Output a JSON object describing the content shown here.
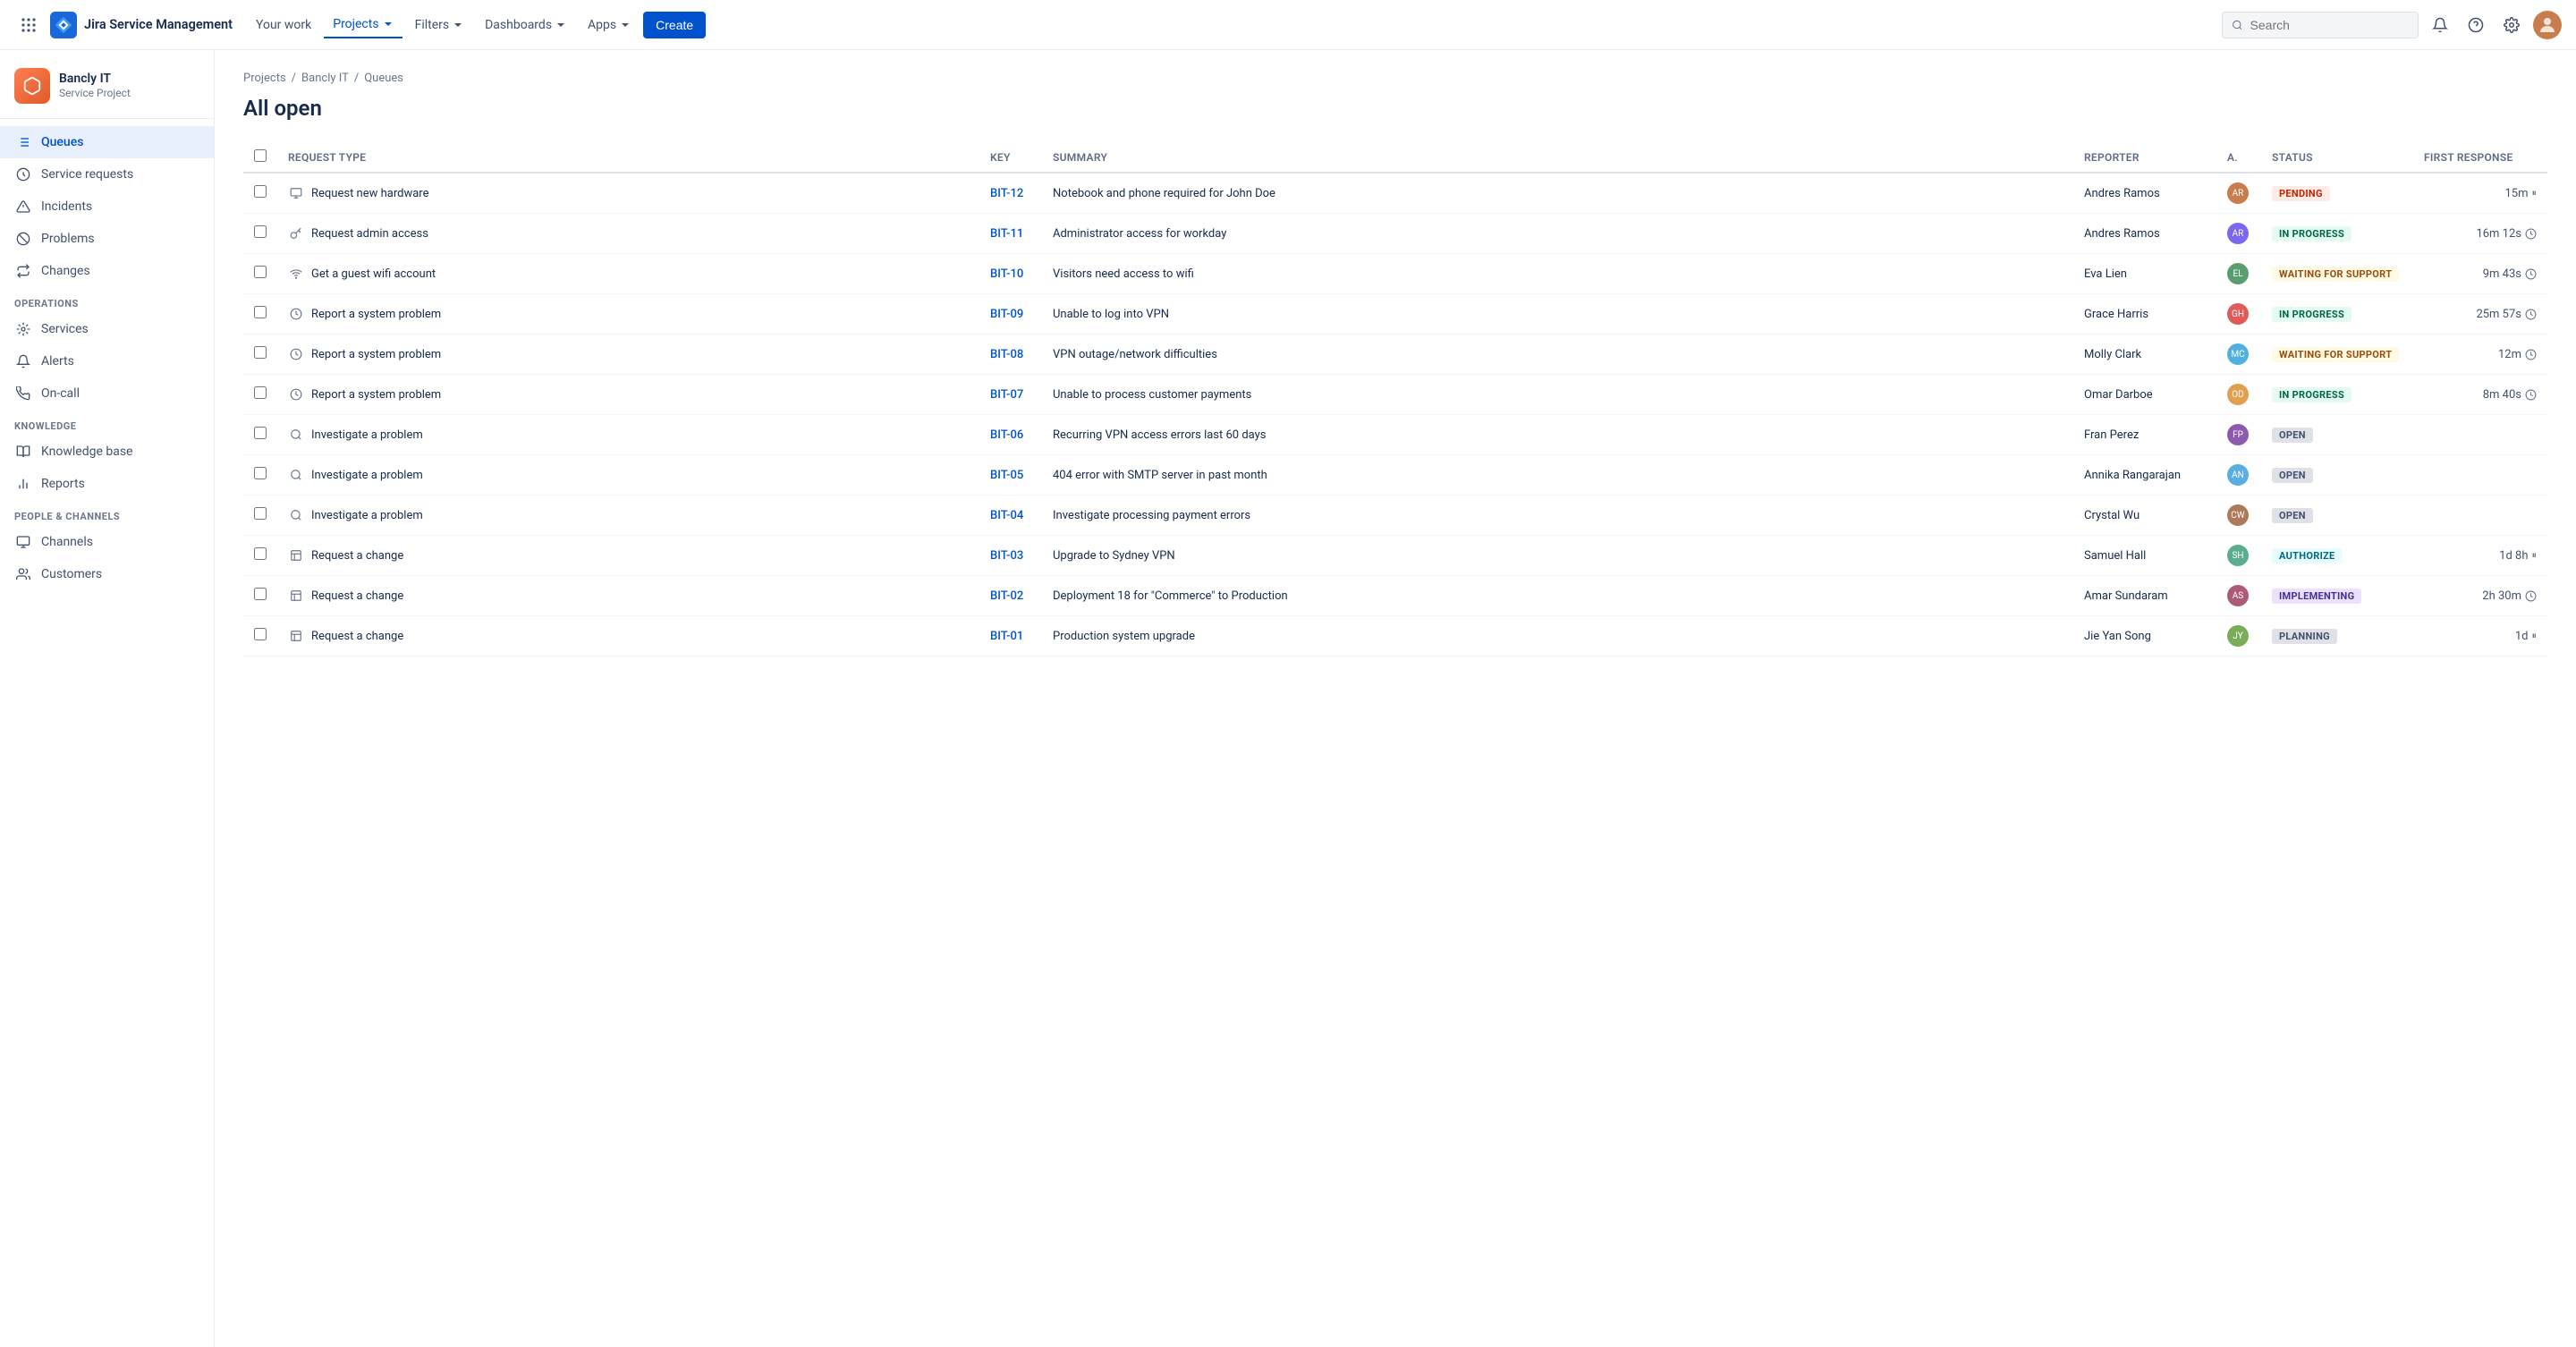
{
  "app": {
    "name": "Jira Service Management"
  },
  "topnav": {
    "logo_text": "Jira Service Management",
    "nav_items": [
      {
        "label": "Your work",
        "active": false
      },
      {
        "label": "Projects",
        "active": true,
        "has_dropdown": true
      },
      {
        "label": "Filters",
        "active": false,
        "has_dropdown": true
      },
      {
        "label": "Dashboards",
        "active": false,
        "has_dropdown": true
      },
      {
        "label": "Apps",
        "active": false,
        "has_dropdown": true
      }
    ],
    "create_label": "Create",
    "search_placeholder": "Search"
  },
  "sidebar": {
    "project_name": "Bancly IT",
    "project_type": "Service Project",
    "nav_items": [
      {
        "label": "Queues",
        "active": true,
        "icon": "queues"
      },
      {
        "label": "Service requests",
        "active": false,
        "icon": "service-requests"
      },
      {
        "label": "Incidents",
        "active": false,
        "icon": "incidents"
      },
      {
        "label": "Problems",
        "active": false,
        "icon": "problems"
      },
      {
        "label": "Changes",
        "active": false,
        "icon": "changes"
      }
    ],
    "sections": [
      {
        "label": "Operations",
        "items": [
          {
            "label": "Services",
            "icon": "services"
          },
          {
            "label": "Alerts",
            "icon": "alerts"
          },
          {
            "label": "On-call",
            "icon": "on-call"
          }
        ]
      },
      {
        "label": "Knowledge",
        "items": [
          {
            "label": "Knowledge base",
            "icon": "knowledge-base"
          },
          {
            "label": "Reports",
            "icon": "reports"
          }
        ]
      },
      {
        "label": "People & Channels",
        "items": [
          {
            "label": "Channels",
            "icon": "channels"
          },
          {
            "label": "Customers",
            "icon": "customers"
          }
        ]
      }
    ]
  },
  "breadcrumb": {
    "items": [
      "Projects",
      "Bancly IT",
      "Queues"
    ]
  },
  "page": {
    "title": "All open"
  },
  "table": {
    "columns": [
      "Request Type",
      "Key",
      "Summary",
      "Reporter",
      "A.",
      "Status",
      "First response"
    ],
    "rows": [
      {
        "request_type": "Request new hardware",
        "request_type_icon": "hardware",
        "key": "BIT-12",
        "summary": "Notebook and phone required for John Doe",
        "reporter": "Andres Ramos",
        "assignee_class": "av-1",
        "assignee_initials": "AR",
        "status": "PENDING",
        "status_class": "status-pending",
        "first_response": "15m",
        "fr_type": "pause"
      },
      {
        "request_type": "Request admin access",
        "request_type_icon": "key",
        "key": "BIT-11",
        "summary": "Administrator access for workday",
        "reporter": "Andres Ramos",
        "assignee_class": "av-2",
        "assignee_initials": "AR",
        "status": "IN PROGRESS",
        "status_class": "status-in-progress",
        "first_response": "16m 12s",
        "fr_type": "clock"
      },
      {
        "request_type": "Get a guest wifi account",
        "request_type_icon": "wifi",
        "key": "BIT-10",
        "summary": "Visitors need access to wifi",
        "reporter": "Eva Lien",
        "assignee_class": "av-3",
        "assignee_initials": "EL",
        "status": "WAITING FOR SUPPORT",
        "status_class": "status-waiting",
        "first_response": "9m 43s",
        "fr_type": "clock"
      },
      {
        "request_type": "Report a system problem",
        "request_type_icon": "system",
        "key": "BIT-09",
        "summary": "Unable to log into VPN",
        "reporter": "Grace Harris",
        "assignee_class": "av-4",
        "assignee_initials": "GH",
        "status": "IN PROGRESS",
        "status_class": "status-in-progress",
        "first_response": "25m 57s",
        "fr_type": "clock"
      },
      {
        "request_type": "Report a system problem",
        "request_type_icon": "system",
        "key": "BIT-08",
        "summary": "VPN outage/network difficulties",
        "reporter": "Molly Clark",
        "assignee_class": "av-5",
        "assignee_initials": "MC",
        "status": "WAITING FOR SUPPORT",
        "status_class": "status-waiting",
        "first_response": "12m",
        "fr_type": "clock"
      },
      {
        "request_type": "Report a system problem",
        "request_type_icon": "system",
        "key": "BIT-07",
        "summary": "Unable to process customer payments",
        "reporter": "Omar Darboe",
        "assignee_class": "av-6",
        "assignee_initials": "OD",
        "status": "IN PROGRESS",
        "status_class": "status-in-progress",
        "first_response": "8m 40s",
        "fr_type": "clock"
      },
      {
        "request_type": "Investigate a problem",
        "request_type_icon": "investigate",
        "key": "BIT-06",
        "summary": "Recurring VPN access errors last 60 days",
        "reporter": "Fran Perez",
        "assignee_class": "av-7",
        "assignee_initials": "FP",
        "status": "OPEN",
        "status_class": "status-open",
        "first_response": "",
        "fr_type": ""
      },
      {
        "request_type": "Investigate a problem",
        "request_type_icon": "investigate",
        "key": "BIT-05",
        "summary": "404 error with SMTP server in past month",
        "reporter": "Annika Rangarajan",
        "assignee_class": "av-8",
        "assignee_initials": "AN",
        "status": "OPEN",
        "status_class": "status-open",
        "first_response": "",
        "fr_type": ""
      },
      {
        "request_type": "Investigate a problem",
        "request_type_icon": "investigate",
        "key": "BIT-04",
        "summary": "Investigate processing payment errors",
        "reporter": "Crystal Wu",
        "assignee_class": "av-9",
        "assignee_initials": "CW",
        "status": "OPEN",
        "status_class": "status-open",
        "first_response": "",
        "fr_type": ""
      },
      {
        "request_type": "Request a change",
        "request_type_icon": "change",
        "key": "BIT-03",
        "summary": "Upgrade to Sydney VPN",
        "reporter": "Samuel Hall",
        "assignee_class": "av-10",
        "assignee_initials": "SH",
        "status": "AUTHORIZE",
        "status_class": "status-authorize",
        "first_response": "1d 8h",
        "fr_type": "pause"
      },
      {
        "request_type": "Request a change",
        "request_type_icon": "change",
        "key": "BIT-02",
        "summary": "Deployment 18 for \"Commerce\" to Production",
        "reporter": "Amar Sundaram",
        "assignee_class": "av-11",
        "assignee_initials": "AS",
        "status": "IMPLEMENTING",
        "status_class": "status-implementing",
        "first_response": "2h 30m",
        "fr_type": "clock"
      },
      {
        "request_type": "Request a change",
        "request_type_icon": "change",
        "key": "BIT-01",
        "summary": "Production system upgrade",
        "reporter": "Jie Yan Song",
        "assignee_class": "av-12",
        "assignee_initials": "JY",
        "status": "PLANNING",
        "status_class": "status-planning",
        "first_response": "1d",
        "fr_type": "pause"
      }
    ]
  }
}
